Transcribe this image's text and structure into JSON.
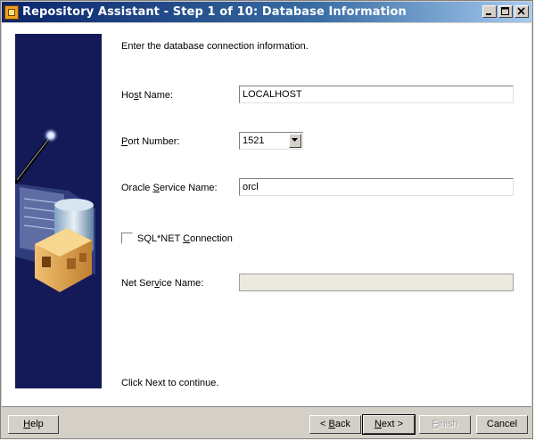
{
  "window": {
    "title": "Repository Assistant - Step 1 of 10: Database Information"
  },
  "form": {
    "instruction": "Enter the database connection information.",
    "host_name_label_pre": "Ho",
    "host_name_label_ul": "s",
    "host_name_label_post": "t Name:",
    "host_name_value": "LOCALHOST",
    "port_label_ul": "P",
    "port_label_post": "ort Number:",
    "port_value": "1521",
    "service_label_pre": "Oracle ",
    "service_label_ul": "S",
    "service_label_post": "ervice Name:",
    "service_value": "orcl",
    "sqlnet_label_pre": "SQL*NET ",
    "sqlnet_label_ul": "C",
    "sqlnet_label_post": "onnection",
    "sqlnet_checked": false,
    "net_service_label_pre": "Net Ser",
    "net_service_label_ul": "v",
    "net_service_label_post": "ice Name:",
    "net_service_value": "",
    "footer": "Click Next to continue."
  },
  "buttons": {
    "help_ul": "H",
    "help_post": "elp",
    "back_pre": "< ",
    "back_ul": "B",
    "back_post": "ack",
    "next_ul": "N",
    "next_post": "ext >",
    "finish_ul": "F",
    "finish_post": "inish",
    "cancel": "Cancel"
  },
  "icons": {
    "app": "repository-assistant-app-icon",
    "minimize": "minimize-icon",
    "maximize": "maximize-icon",
    "close": "close-icon",
    "dropdown": "chevron-down-icon"
  },
  "colors": {
    "titlebar_start": "#0a246a",
    "titlebar_end": "#a6caf0",
    "side_panel": "#141a57",
    "window_face": "#d4d0c8"
  }
}
